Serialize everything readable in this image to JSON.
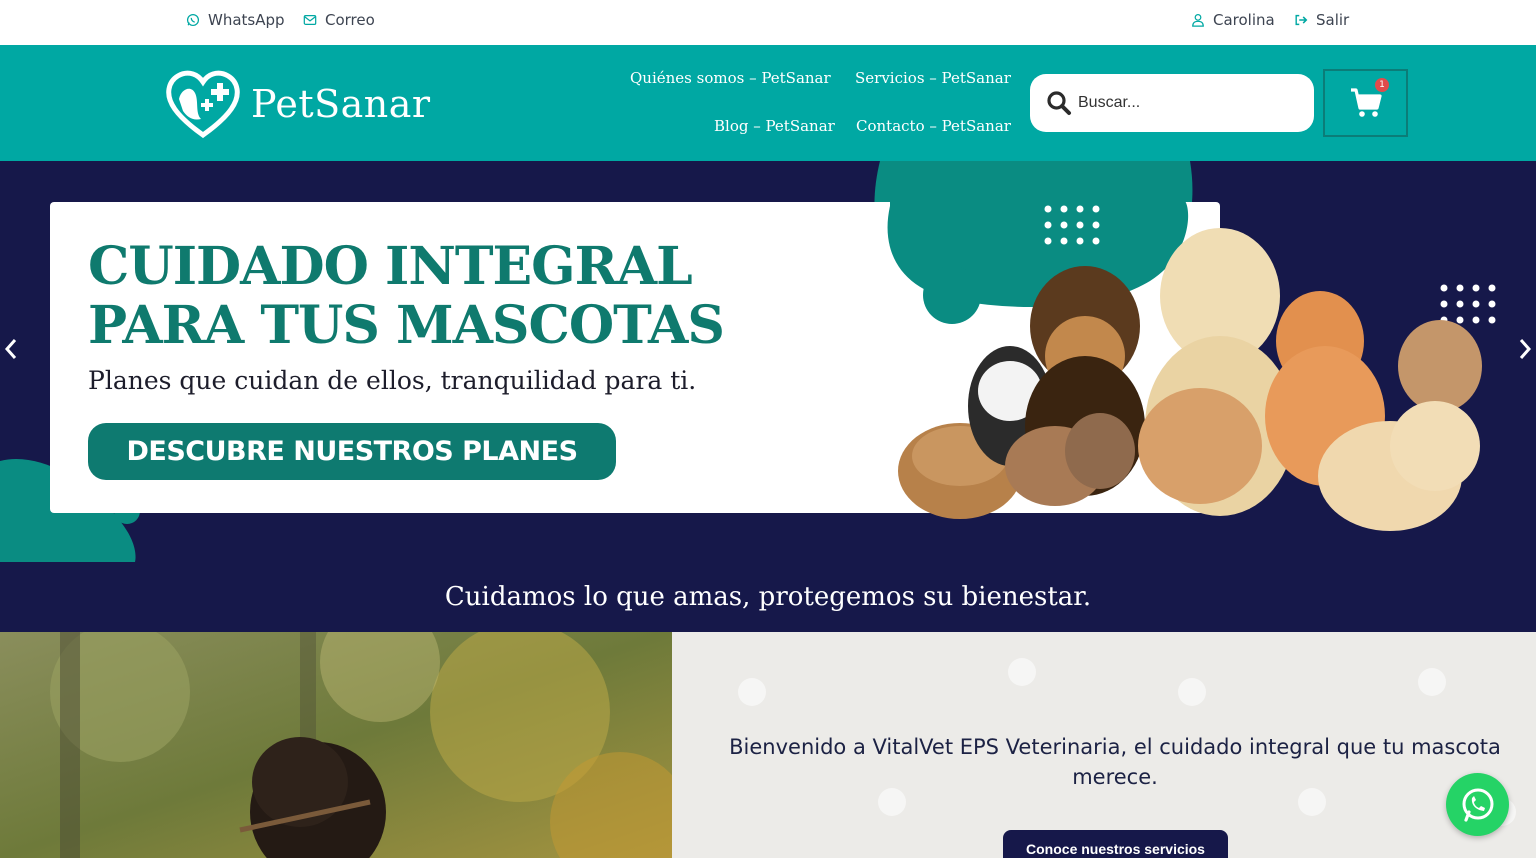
{
  "topbar": {
    "whatsapp_label": "WhatsApp",
    "email_label": "Correo",
    "user_name": "Carolina",
    "logout_label": "Salir",
    "icon_color": "#00a8a3"
  },
  "header": {
    "brand": "PetSanar",
    "nav": [
      {
        "label": "Quiénes somos – PetSanar"
      },
      {
        "label": "Servicios – PetSanar"
      },
      {
        "label": "Blog – PetSanar"
      },
      {
        "label": "Contacto – PetSanar"
      }
    ],
    "search_placeholder": "Buscar...",
    "cart_count": "1",
    "background": "#00a8a3"
  },
  "hero": {
    "title_line1": "CUIDADO INTEGRAL",
    "title_line2": "PARA TUS MASCOTAS",
    "subtitle": "Planes que cuidan de ellos, tranquilidad para ti.",
    "cta": "DESCUBRE NUESTROS PLANES",
    "prev_icon": "chevron-left-icon",
    "next_icon": "chevron-right-icon",
    "background": "#16184a",
    "accent": "#0e7a70"
  },
  "tagline": {
    "text": "Cuidamos lo que amas, protegemos su bienestar."
  },
  "welcome": {
    "text": "Bienvenido a VitalVet EPS Veterinaria, el cuidado integral que tu mascota merece.",
    "button": "Conoce nuestros servicios"
  },
  "floating": {
    "icon": "whatsapp-icon",
    "color": "#25d366"
  }
}
